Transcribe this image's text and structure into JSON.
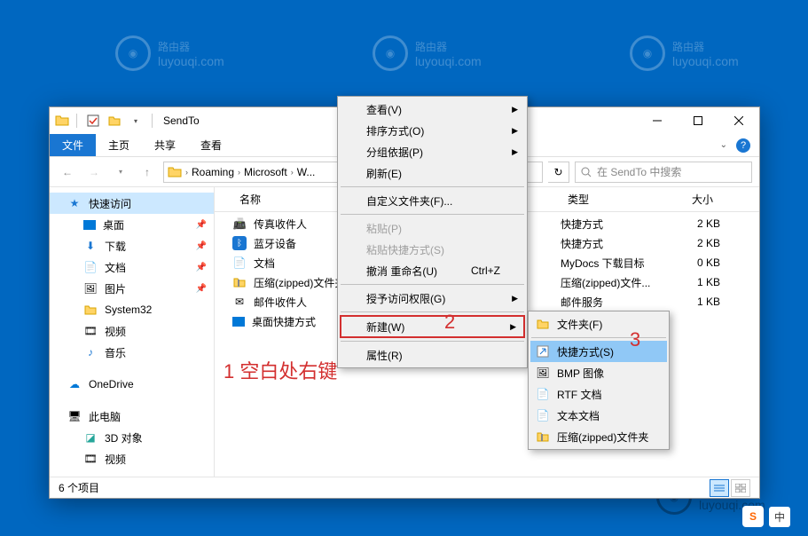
{
  "watermark": {
    "text": "路由器",
    "sub": "luyouqi.com"
  },
  "window": {
    "title": "SendTo",
    "tabs": {
      "file": "文件",
      "home": "主页",
      "share": "共享",
      "view": "查看"
    },
    "breadcrumb": [
      "Roaming",
      "Microsoft",
      "W..."
    ],
    "search_placeholder": "在 SendTo 中搜索",
    "status": "6 个项目"
  },
  "sidebar": {
    "quick": "快速访问",
    "items": [
      {
        "label": "桌面",
        "pin": true
      },
      {
        "label": "下载",
        "pin": true
      },
      {
        "label": "文档",
        "pin": true
      },
      {
        "label": "图片",
        "pin": true
      },
      {
        "label": "System32",
        "pin": false
      },
      {
        "label": "视频",
        "pin": false
      },
      {
        "label": "音乐",
        "pin": false
      }
    ],
    "onedrive": "OneDrive",
    "thispc": "此电脑",
    "pcitems": [
      {
        "label": "3D 对象"
      },
      {
        "label": "视频"
      }
    ]
  },
  "columns": {
    "name": "名称",
    "type": "类型",
    "size": "大小"
  },
  "files": [
    {
      "name": "传真收件人",
      "type": "快捷方式",
      "size": "2 KB",
      "icon": "fax"
    },
    {
      "name": "蓝牙设备",
      "type": "快捷方式",
      "size": "2 KB",
      "icon": "bluetooth"
    },
    {
      "name": "文档",
      "type": "MyDocs 下载目标",
      "size": "0 KB",
      "icon": "doc"
    },
    {
      "name": "压缩(zipped)文件夹",
      "type": "压缩(zipped)文件...",
      "size": "1 KB",
      "icon": "zip"
    },
    {
      "name": "邮件收件人",
      "type": "邮件服务",
      "size": "1 KB",
      "icon": "mail"
    },
    {
      "name": "桌面快捷方式",
      "type": "",
      "size": "",
      "icon": "desktop"
    }
  ],
  "ctx1": {
    "view": "查看(V)",
    "sort": "排序方式(O)",
    "group": "分组依据(P)",
    "refresh": "刷新(E)",
    "customize": "自定义文件夹(F)...",
    "paste": "粘贴(P)",
    "paste_shortcut": "粘贴快捷方式(S)",
    "undo": "撤消 重命名(U)",
    "undo_key": "Ctrl+Z",
    "grant": "授予访问权限(G)",
    "new": "新建(W)",
    "properties": "属性(R)"
  },
  "ctx2": {
    "folder": "文件夹(F)",
    "shortcut": "快捷方式(S)",
    "bmp": "BMP 图像",
    "rtf": "RTF 文档",
    "txt": "文本文档",
    "zip": "压缩(zipped)文件夹"
  },
  "annotations": {
    "a1": "1 空白处右键",
    "a2": "2",
    "a3": "3"
  },
  "ime": "中"
}
